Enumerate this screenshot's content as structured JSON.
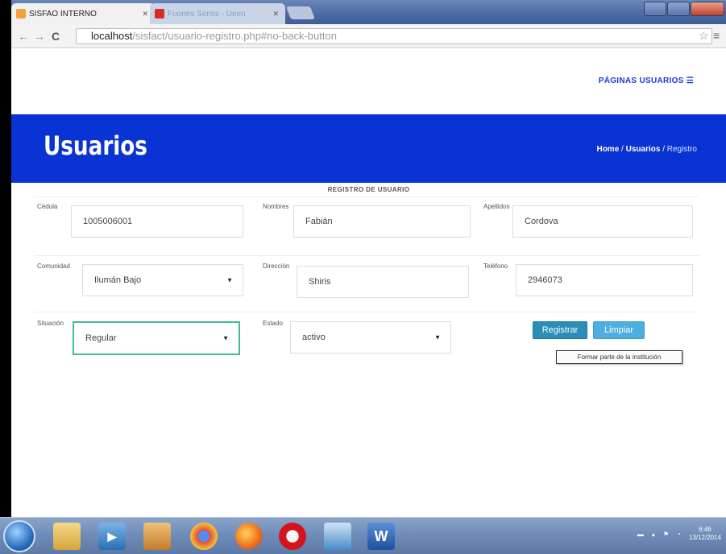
{
  "browser": {
    "tabs": [
      {
        "title": "SISFAO INTERNO",
        "active": true
      },
      {
        "title": "Fuones Seriss - Ueen",
        "active": false
      }
    ],
    "url_host": "localhost",
    "url_path": "/sisfact/usuario-registro.php#no-back-button"
  },
  "nav": {
    "menu_label": "PÁGINAS USUARIOS ☰"
  },
  "banner": {
    "title": "Usuarios",
    "breadcrumb": {
      "home": "Home",
      "sep1": "/",
      "section": "Usuarios",
      "sep2": "/",
      "current": "Registro"
    }
  },
  "form": {
    "title": "REGISTRO DE USUARIO",
    "fields": {
      "cedula": {
        "label": "Cédula",
        "value": "1005006001"
      },
      "nombres": {
        "label": "Nombres",
        "value": "Fabián"
      },
      "apellidos": {
        "label": "Apellidos",
        "value": "Cordova"
      },
      "comunidad": {
        "label": "Comunidad",
        "value": "Ilumán Bajo"
      },
      "direccion": {
        "label": "Dirección",
        "value": "Shiris"
      },
      "telefono": {
        "label": "Teléfono",
        "value": "2946073"
      },
      "situacion": {
        "label": "Situación",
        "value": "Regular"
      },
      "estado": {
        "label": "Estado",
        "value": "activo"
      }
    },
    "buttons": {
      "registrar": "Registrar",
      "limpiar": "Limpiar"
    },
    "tooltip": "Formar parte de la institución"
  },
  "taskbar": {
    "apps": [
      "windows-explorer",
      "media-player",
      "paint",
      "chrome",
      "firefox",
      "opera",
      "virtualbox",
      "word"
    ],
    "clock_time": "6:46",
    "clock_date": "13/12/2014"
  },
  "colors": {
    "banner": "#0a33d3",
    "accent_button": "#2b8eb8",
    "focus_border": "#3fbf8b"
  }
}
